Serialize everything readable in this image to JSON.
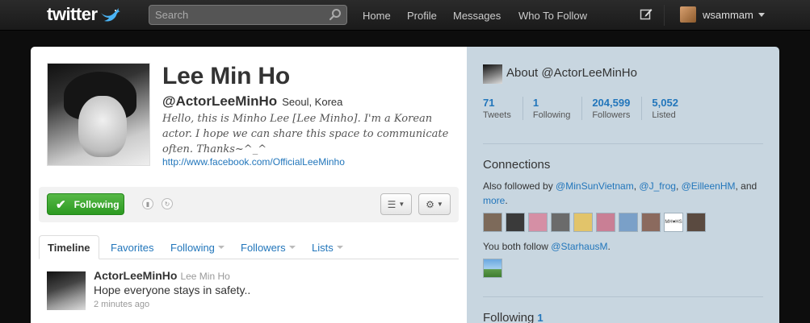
{
  "topbar": {
    "logo_text": "twitter",
    "search_placeholder": "Search",
    "nav": [
      "Home",
      "Profile",
      "Messages",
      "Who To Follow"
    ],
    "username": "wsammam"
  },
  "profile": {
    "name": "Lee Min Ho",
    "handle": "@ActorLeeMinHo",
    "location": "Seoul, Korea",
    "bio": "Hello, this is Minho Lee [Lee Minho]. I'm a Korean actor. I hope we can share this space to communicate often. Thanks~^_^",
    "url": "http://www.facebook.com/OfficialLeeMinho"
  },
  "actions": {
    "following_label": "Following"
  },
  "tabs": {
    "timeline": "Timeline",
    "favorites": "Favorites",
    "following": "Following",
    "followers": "Followers",
    "lists": "Lists"
  },
  "tweet": {
    "user": "ActorLeeMinHo",
    "realname": "Lee Min Ho",
    "text": "Hope everyone stays in safety..",
    "time": "2 minutes ago"
  },
  "sidebar": {
    "about_title": "About @ActorLeeMinHo",
    "stats": [
      {
        "num": "71",
        "label": "Tweets"
      },
      {
        "num": "1",
        "label": "Following"
      },
      {
        "num": "204,599",
        "label": "Followers"
      },
      {
        "num": "5,052",
        "label": "Listed"
      }
    ],
    "connections_title": "Connections",
    "also_prefix": "Also followed by ",
    "also_users": [
      "@MinSunVietnam",
      "@J_frog",
      "@EilleenHM"
    ],
    "also_and": ", and",
    "also_more": "more",
    "face_colors": [
      "#7d6a5a",
      "#3a3a3a",
      "#d58fa5",
      "#6b6b6b",
      "#e2c46a",
      "#c97f95",
      "#7aa0c8",
      "#8b6a5e",
      "#ffffff",
      "#5a4a40"
    ],
    "mh_label": "MH♥HS",
    "both_follow_prefix": "You both follow ",
    "both_follow_user": "@StarhausM",
    "following_title": "Following",
    "following_count": "1"
  },
  "colors": {
    "link": "#2276bb",
    "follow_green": "#2c9a21",
    "sidebar_bg": "#c8d6e0"
  }
}
